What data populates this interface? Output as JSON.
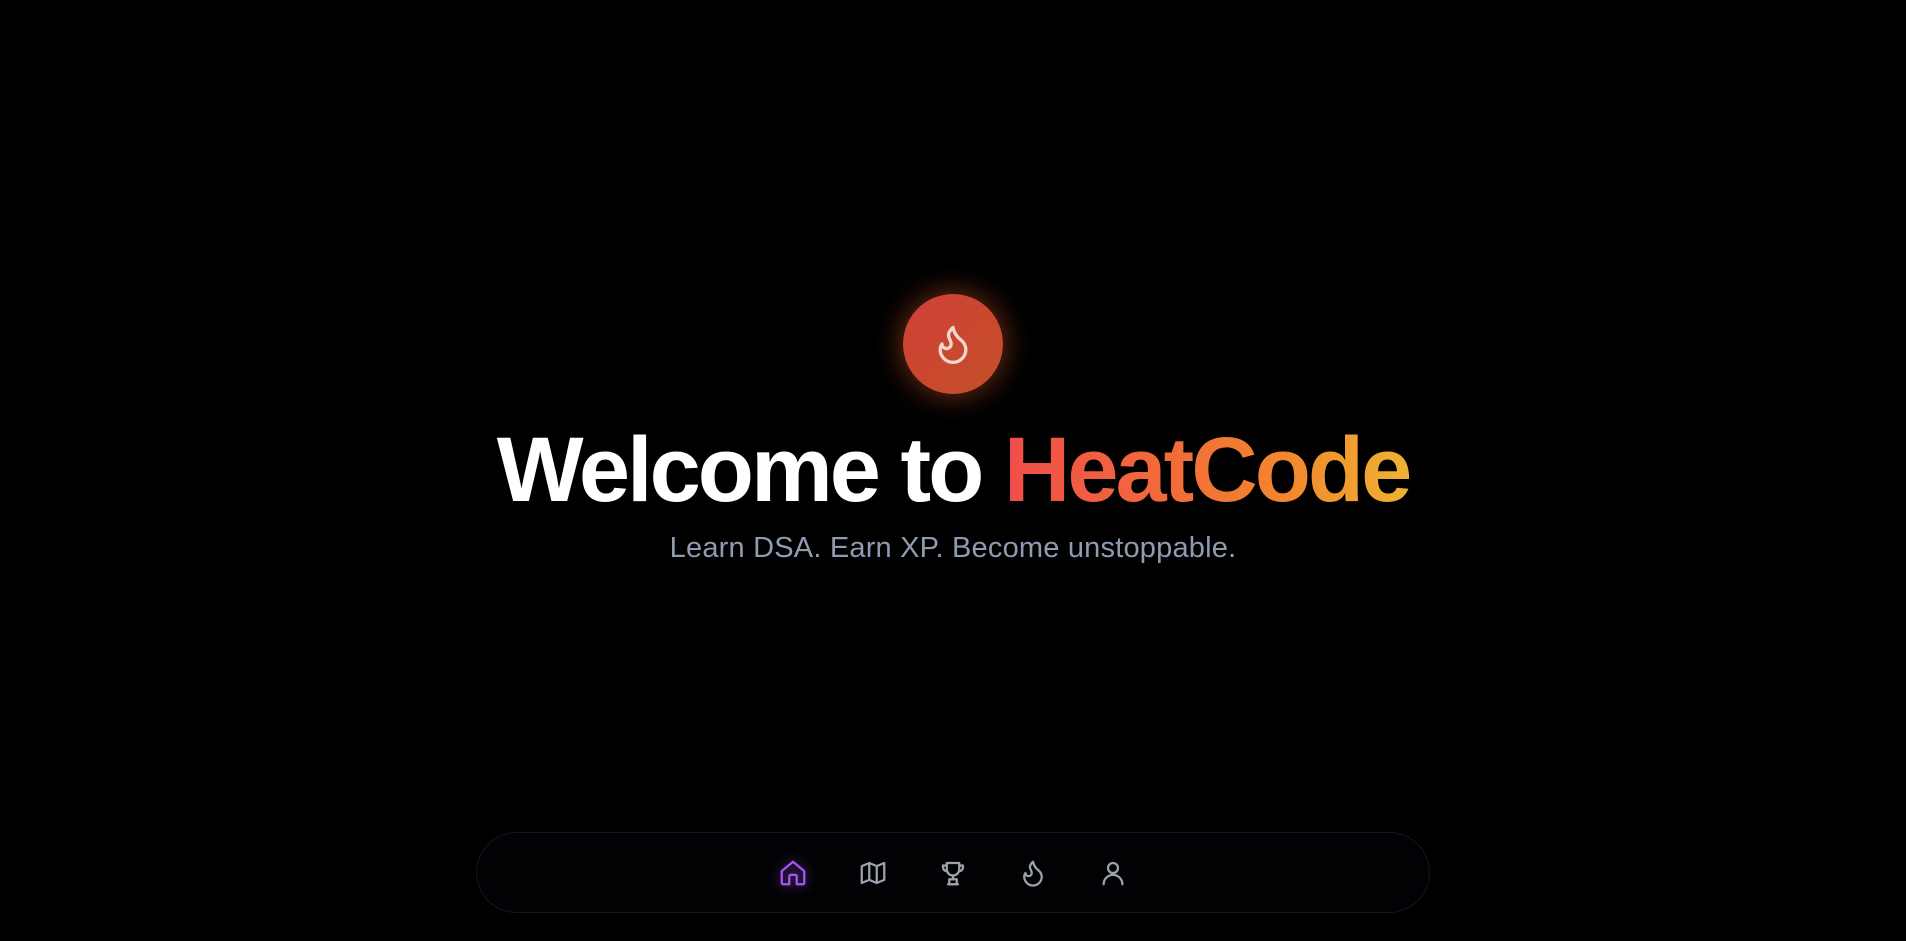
{
  "hero": {
    "logo_icon": "flame-icon",
    "headline_prefix": "Welcome to ",
    "headline_brand": "HeatCode",
    "tagline": "Learn DSA. Earn XP. Become unstoppable."
  },
  "bottom_nav": {
    "items": [
      {
        "icon": "home-icon",
        "active": true
      },
      {
        "icon": "map-icon",
        "active": false
      },
      {
        "icon": "trophy-icon",
        "active": false
      },
      {
        "icon": "flame-icon",
        "active": false
      },
      {
        "icon": "user-icon",
        "active": false
      }
    ]
  },
  "colors": {
    "background": "#000000",
    "active_nav": "#a855f7",
    "inactive_nav": "#9ca3af",
    "brand_gradient_start": "#f04e4a",
    "brand_gradient_end": "#eeb332",
    "tagline": "#8f9bb0"
  }
}
